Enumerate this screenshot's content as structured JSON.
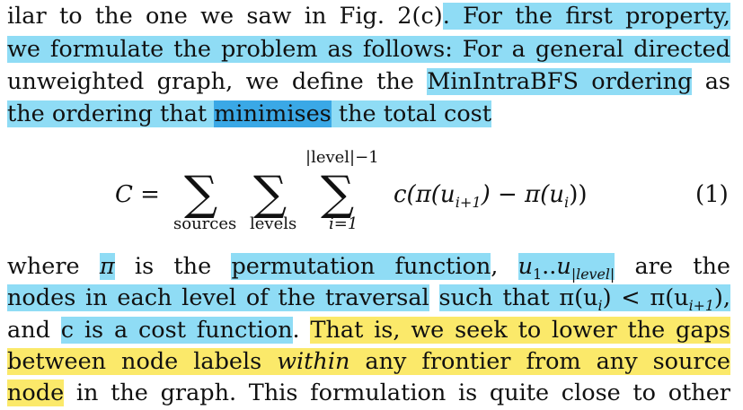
{
  "lines": [
    {
      "p": [
        "ilar to the one we saw in Fig. 2(c)",
        ". For the first property,"
      ]
    },
    {
      "p": [
        "we formulate the problem as follows: For a general ",
        "directed"
      ]
    },
    {
      "p": [
        "unweighted graph, we define the ",
        "MinIntraBFS ordering",
        " as"
      ]
    },
    {
      "p": [
        "the ordering that ",
        "minimises",
        " the total cost"
      ]
    }
  ],
  "equation": {
    "lhs": "C =",
    "sum_symbol": "∑",
    "sub1": "sources",
    "sub2": "levels",
    "sub3": "i=1",
    "sup3": "|level|−1",
    "body": "c(π(u",
    "body_sub1": "i+1",
    "body_mid": ") − π(u",
    "body_sub2": "i",
    "body_end": "))",
    "number": "(1)"
  },
  "after": {
    "l1": [
      "where ",
      "π",
      " is the ",
      "permutation function",
      ", ",
      "u",
      "1",
      "..",
      "u",
      "|level|",
      " are the"
    ],
    "l2": [
      "nodes in each level of the traversal",
      " ",
      "such that π(u",
      "i",
      ") < π(u",
      "i+1",
      "),"
    ],
    "l3": [
      "and ",
      "c is a cost function",
      ". ",
      "That is, we seek to lower the gaps"
    ],
    "l4": [
      "between node labels ",
      "within",
      " any frontier from any source"
    ],
    "l5": [
      "node",
      " in the graph. This formulation is quite close to other"
    ]
  }
}
